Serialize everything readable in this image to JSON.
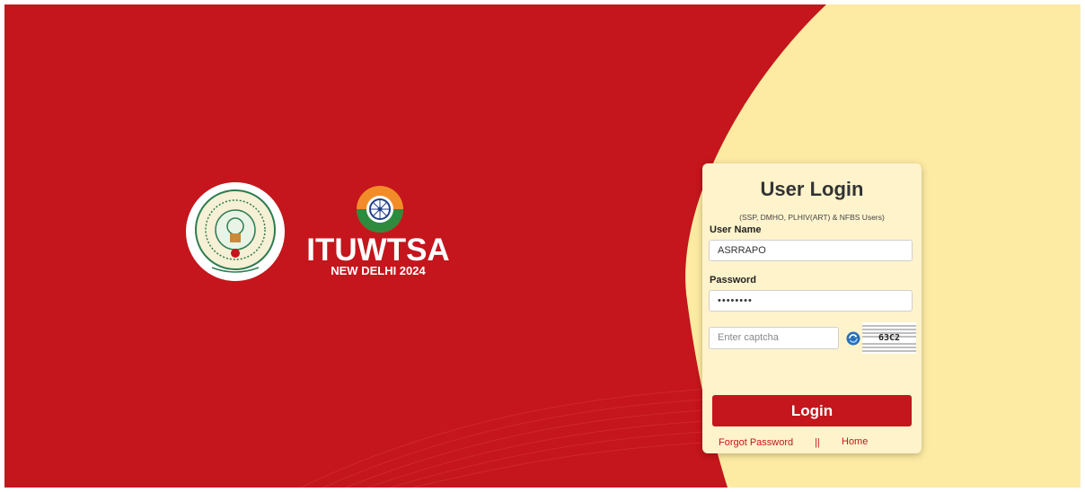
{
  "colors": {
    "brand_red": "#c4161c",
    "panel_yellow": "#fdeba3",
    "card_bg": "#fff3cc"
  },
  "emblem": {
    "icon": "andhra-pradesh-emblem-icon"
  },
  "itu_logo": {
    "icon": "itu-wtsa-mark-icon",
    "word": "ITUWTSA",
    "subtitle": "NEW DELHI 2024"
  },
  "login": {
    "title": "User Login",
    "subtitle": "(SSP, DMHO, PLHIV(ART) & NFBS Users)",
    "username_label": "User Name",
    "username_value": "ASRRAPO",
    "password_label": "Password",
    "password_value": "••••••••",
    "captcha_placeholder": "Enter captcha",
    "captcha_text": "63C2",
    "refresh_icon": "refresh-icon",
    "login_button": "Login",
    "forgot_link": "Forgot Password",
    "separator": "||",
    "home_link": "Home"
  }
}
